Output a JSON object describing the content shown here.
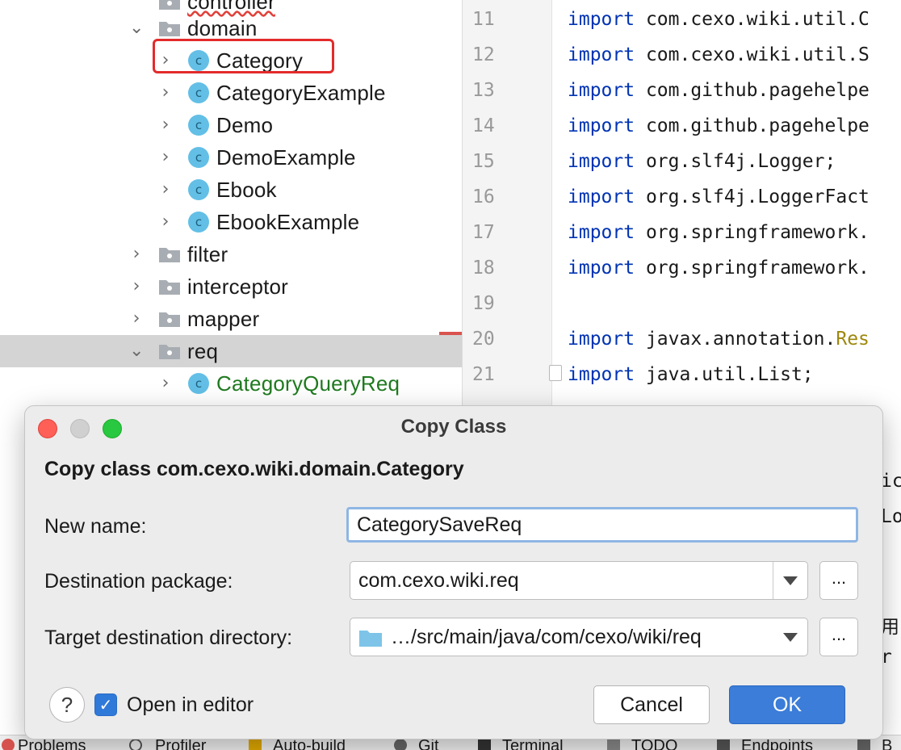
{
  "tree": {
    "items": [
      {
        "label": "controller"
      },
      {
        "label": "domain"
      },
      {
        "label": "Category"
      },
      {
        "label": "CategoryExample"
      },
      {
        "label": "Demo"
      },
      {
        "label": "DemoExample"
      },
      {
        "label": "Ebook"
      },
      {
        "label": "EbookExample"
      },
      {
        "label": "filter"
      },
      {
        "label": "interceptor"
      },
      {
        "label": "mapper"
      },
      {
        "label": "req"
      },
      {
        "label": "CategoryQueryReq"
      }
    ],
    "class_badge": "c"
  },
  "editor": {
    "lines": [
      {
        "num": "11",
        "kw": "import",
        "text": " com.cexo.wiki.util.C"
      },
      {
        "num": "12",
        "kw": "import",
        "text": " com.cexo.wiki.util.S"
      },
      {
        "num": "13",
        "kw": "import",
        "text": " com.github.pagehelpe"
      },
      {
        "num": "14",
        "kw": "import",
        "text": " com.github.pagehelpe"
      },
      {
        "num": "15",
        "kw": "import",
        "text": " org.slf4j.Logger;"
      },
      {
        "num": "16",
        "kw": "import",
        "text": " org.slf4j.LoggerFact"
      },
      {
        "num": "17",
        "kw": "import",
        "text": " org.springframework."
      },
      {
        "num": "18",
        "kw": "import",
        "text": " org.springframework."
      },
      {
        "num": "19",
        "kw": "",
        "text": ""
      },
      {
        "num": "20",
        "kw": "import",
        "text": " javax.annotation.",
        "ann": "Res"
      },
      {
        "num": "21",
        "kw": "import",
        "text": " java.util.List;"
      }
    ],
    "fragments": [
      "ic",
      "Lo",
      "用",
      "r"
    ]
  },
  "dialog": {
    "title": "Copy Class",
    "heading": "Copy class com.cexo.wiki.domain.Category",
    "new_name_label": "New name:",
    "new_name_value": "CategorySaveReq",
    "dest_package_label": "Destination package:",
    "dest_package_value": "com.cexo.wiki.req",
    "target_dir_label": "Target destination directory:",
    "target_dir_value": "…/src/main/java/com/cexo/wiki/req",
    "browse_label": "...",
    "help_label": "?",
    "open_in_editor_label": "Open in editor",
    "open_in_editor_checked": true,
    "cancel_label": "Cancel",
    "ok_label": "OK"
  },
  "toolbar": {
    "items": [
      "Problems",
      "Profiler",
      "Auto-build",
      "Git",
      "Terminal",
      "TODO",
      "Endpoints",
      "B"
    ]
  },
  "colors": {
    "accent": "#3b7dd8",
    "highlight_box": "#e32b2b",
    "keyword": "#0033b3",
    "class_icon": "#63bfe6",
    "package_green": "#1f7a1f"
  }
}
